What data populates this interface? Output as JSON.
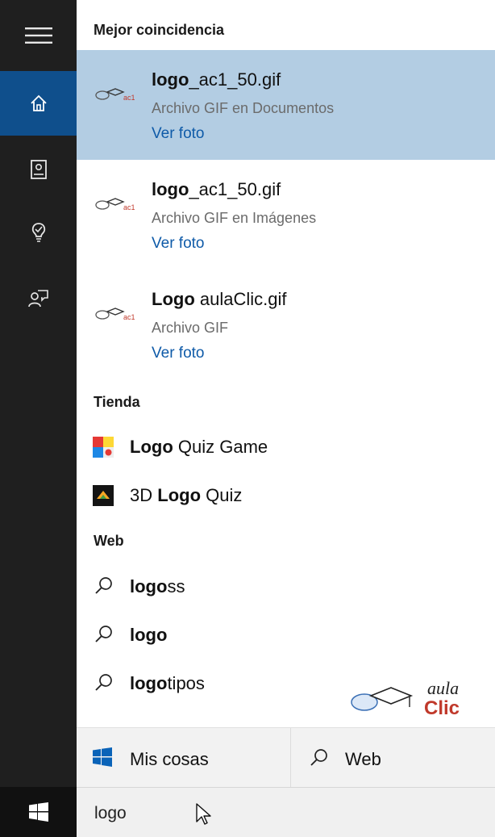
{
  "search": {
    "query": "logo"
  },
  "sections": {
    "best_match": "Mejor coincidencia",
    "store": "Tienda",
    "web": "Web"
  },
  "results": [
    {
      "title_bold": "logo",
      "title_rest": "_ac1_50.gif",
      "subtitle": "Archivo GIF en Documentos",
      "link": "Ver foto",
      "selected": true
    },
    {
      "title_bold": "logo",
      "title_rest": "_ac1_50.gif",
      "subtitle": "Archivo GIF en Imágenes",
      "link": "Ver foto",
      "selected": false
    },
    {
      "title_bold": "Logo",
      "title_rest": " aulaClic.gif",
      "subtitle": "Archivo GIF",
      "link": "Ver foto",
      "selected": false
    }
  ],
  "store_items": [
    {
      "prefix": "",
      "bold": "Logo",
      "rest": " Quiz Game",
      "icon": "logo-quiz-game-icon"
    },
    {
      "prefix": "3D ",
      "bold": "Logo",
      "rest": " Quiz",
      "icon": "3d-logo-quiz-icon"
    }
  ],
  "web_items": [
    {
      "bold": "logo",
      "rest": "ss"
    },
    {
      "bold": "logo",
      "rest": ""
    },
    {
      "bold": "logo",
      "rest": "tipos"
    }
  ],
  "bottom_tabs": {
    "mis_cosas": "Mis cosas",
    "web": "Web"
  },
  "watermark": {
    "line1": "aula",
    "line2": "Clic"
  },
  "thumb_text": "ac1e",
  "colors": {
    "rail": "#1f1f1f",
    "rail_active": "#0f4f8c",
    "selected": "#b3cde3",
    "link": "#0e5aa8"
  }
}
